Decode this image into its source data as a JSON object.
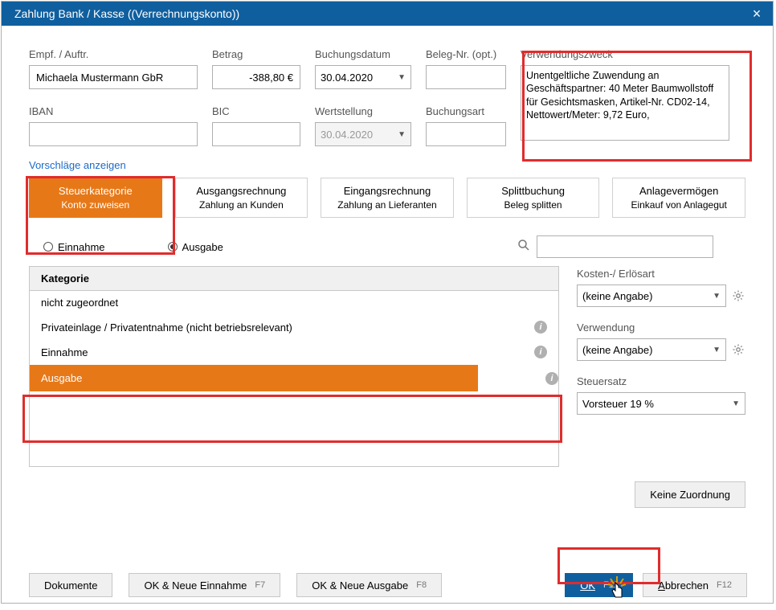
{
  "title": "Zahlung Bank / Kasse ((Verrechnungskonto))",
  "fields": {
    "empf_label": "Empf. / Auftr.",
    "empf_value": "Michaela Mustermann GbR",
    "betrag_label": "Betrag",
    "betrag_value": "-388,80 €",
    "bdatum_label": "Buchungsdatum",
    "bdatum_value": "30.04.2020",
    "beleg_label": "Beleg-Nr. (opt.)",
    "beleg_value": "",
    "iban_label": "IBAN",
    "iban_value": "",
    "bic_label": "BIC",
    "bic_value": "",
    "wert_label": "Wertstellung",
    "wert_value": "30.04.2020",
    "bart_label": "Buchungsart",
    "bart_value": "",
    "zweck_label": "Verwendungszweck",
    "zweck_value": "Unentgeltliche Zuwendung an Geschäftspartner: 40 Meter Baumwollstoff für Gesichtsmasken, Artikel-Nr. CD02-14,  Nettowert/Meter: 9,72 Euro,"
  },
  "link_vorschlaege": "Vorschläge anzeigen",
  "pills": {
    "p1_t": "Steuerkategorie",
    "p1_s": "Konto zuweisen",
    "p2_t": "Ausgangsrechnung",
    "p2_s": "Zahlung an Kunden",
    "p3_t": "Eingangsrechnung",
    "p3_s": "Zahlung an Lieferanten",
    "p4_t": "Splittbuchung",
    "p4_s": "Beleg splitten",
    "p5_t": "Anlagevermögen",
    "p5_s": "Einkauf von Anlagegut"
  },
  "radio": {
    "einnahme": "Einnahme",
    "ausgabe": "Ausgabe"
  },
  "cat_header": "Kategorie",
  "cats": {
    "c1": "nicht zugeordnet",
    "c2": "Privateinlage / Privatentnahme  (nicht betriebsrelevant)",
    "c3": "Einnahme",
    "c4": "Ausgabe"
  },
  "right": {
    "kosten_label": "Kosten-/ Erlösart",
    "kosten_value": "(keine Angabe)",
    "verw_label": "Verwendung",
    "verw_value": "(keine Angabe)",
    "steuer_label": "Steuersatz",
    "steuer_value": "Vorsteuer 19 %"
  },
  "no_assign": "Keine Zuordnung",
  "footer": {
    "doc": "Dokumente",
    "ok_ein": "OK & Neue Einnahme",
    "ok_ein_k": "F7",
    "ok_aus": "OK & Neue Ausgabe",
    "ok_aus_k": "F8",
    "ok": "OK",
    "ok_k": "F11",
    "cancel": "Abbrechen",
    "cancel_k": "F12"
  }
}
